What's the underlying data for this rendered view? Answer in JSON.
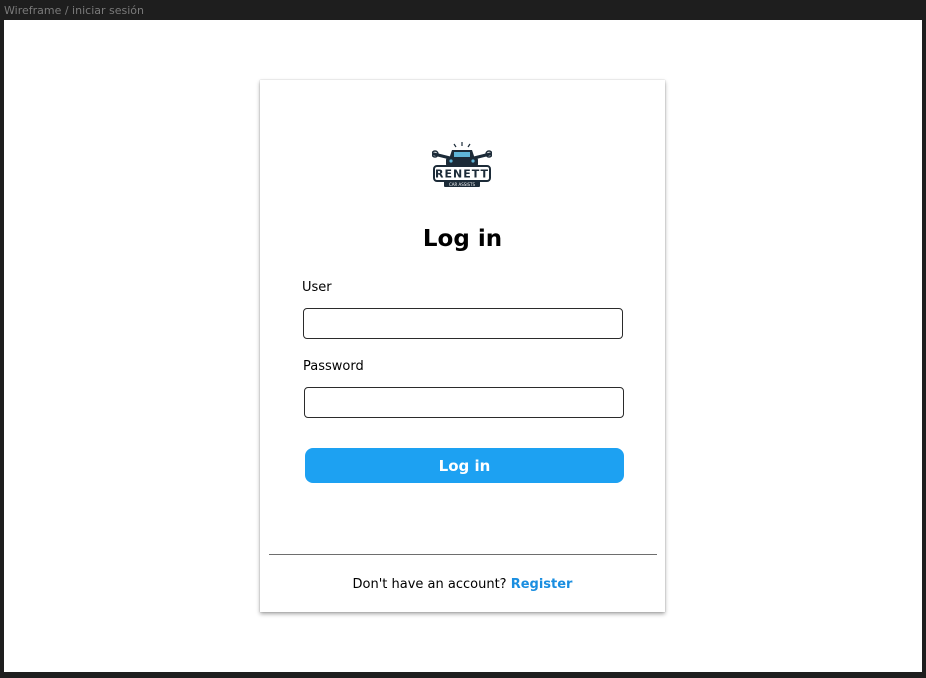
{
  "frame": {
    "label": "Wireframe / iniciar sesión"
  },
  "logo": {
    "icon": "car-logo-icon",
    "brand_text": "RENETT",
    "tagline": "CAR ASSISTS"
  },
  "form": {
    "title": "Log in",
    "user_label": "User",
    "user_value": "",
    "password_label": "Password",
    "password_value": "",
    "submit_label": "Log in"
  },
  "footer": {
    "prompt": "Don't have an account? ",
    "register_label": "Register"
  },
  "colors": {
    "accent": "#1da1f2",
    "link": "#1a8ee0",
    "background_outer": "#1e1e1e",
    "canvas": "#ffffff"
  }
}
